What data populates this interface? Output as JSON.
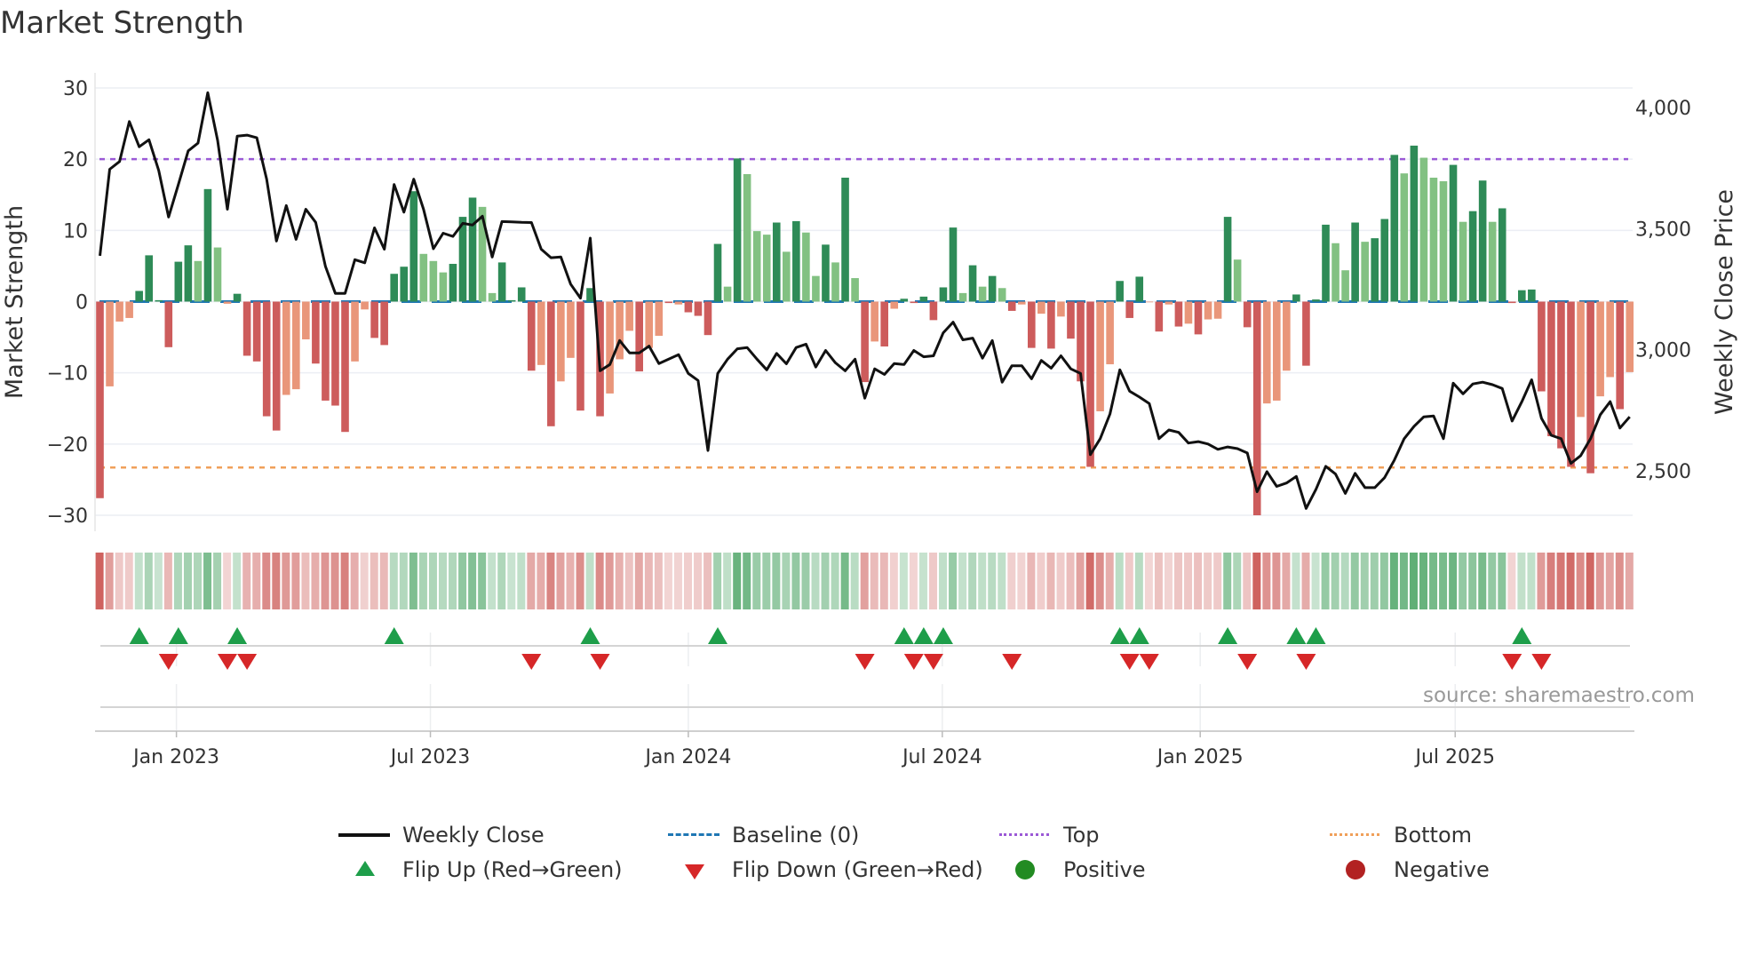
{
  "chart_data": {
    "type": "bar",
    "title": "Market Strength",
    "ylabel": "Market Strength",
    "y2label": "Weekly Close Price",
    "ylim": [
      -32,
      32
    ],
    "y2lim": [
      2317,
      4081
    ],
    "yticks": [
      -30,
      -20,
      -10,
      0,
      10,
      20,
      30
    ],
    "ytick_labels": [
      "−30",
      "−20",
      "−10",
      "0",
      "10",
      "20",
      "30"
    ],
    "y2ticks": [
      2500,
      3000,
      3500,
      4000
    ],
    "y2tick_labels": [
      "2,500",
      "3,000",
      "3,500",
      "4,000"
    ],
    "xtick_week_index": [
      7.8,
      33.7,
      60,
      85.9,
      112.2,
      138.2
    ],
    "xtick_labels": [
      "Jan 2023",
      "Jul 2023",
      "Jan 2024",
      "Jul 2024",
      "Jan 2025",
      "Jul 2025"
    ],
    "top_level": 20,
    "bottom_level": -23.3,
    "baseline": 0,
    "strength": [
      -27.6,
      -11.9,
      -2.8,
      -2.3,
      1.5,
      6.5,
      0.2,
      -6.4,
      5.6,
      7.9,
      5.7,
      15.8,
      7.6,
      -0.3,
      1.1,
      -7.6,
      -8.4,
      -16.1,
      -18.1,
      -13.1,
      -12.3,
      -5.3,
      -8.7,
      -13.9,
      -14.6,
      -18.3,
      -8.4,
      -1.1,
      -5.1,
      -6.1,
      3.9,
      4.9,
      15.5,
      6.7,
      5.7,
      4.1,
      5.3,
      11.9,
      14.6,
      13.3,
      1.2,
      5.5,
      0.2,
      2.0,
      -9.7,
      -8.9,
      -17.5,
      -11.2,
      -7.9,
      -15.3,
      1.9,
      -16.1,
      -12.9,
      -8.1,
      -4.1,
      -9.8,
      -6.5,
      -4.8,
      -0.2,
      -0.4,
      -1.5,
      -2.0,
      -4.7,
      8.1,
      2.1,
      20.1,
      17.9,
      9.9,
      9.4,
      11.1,
      7.0,
      11.3,
      9.7,
      3.6,
      8.0,
      5.5,
      17.4,
      3.3,
      -11.3,
      -5.6,
      -6.3,
      -1.0,
      0.4,
      -0.2,
      0.7,
      -2.6,
      2.0,
      10.4,
      1.2,
      5.1,
      2.1,
      3.6,
      1.9,
      -1.3,
      -0.4,
      -6.5,
      -1.7,
      -6.6,
      -2.1,
      -5.2,
      -11.2,
      -23.2,
      -15.4,
      -8.8,
      2.9,
      -2.3,
      3.5,
      -0.1,
      -4.2,
      -0.4,
      -3.5,
      -3.1,
      -4.6,
      -2.5,
      -2.4,
      11.9,
      5.9,
      -3.6,
      -30.0,
      -14.3,
      -13.9,
      -9.7,
      1.0,
      -9.0,
      0.3,
      10.8,
      8.2,
      4.4,
      11.1,
      8.4,
      8.9,
      11.6,
      20.6,
      18.0,
      21.9,
      20.2,
      17.4,
      16.9,
      19.2,
      11.2,
      12.7,
      17.0,
      11.2,
      13.1,
      -0.2,
      1.6,
      1.7,
      -12.6,
      -18.9,
      -20.6,
      -23.2,
      -16.2,
      -24.1,
      -13.3,
      -10.6,
      -15.1,
      -9.9
    ],
    "shade": [
      "D",
      "L",
      "L",
      "L",
      "D",
      "D",
      "D",
      "D",
      "D",
      "D",
      "L",
      "D",
      "L",
      "L",
      "D",
      "D",
      "D",
      "D",
      "D",
      "L",
      "L",
      "L",
      "D",
      "D",
      "D",
      "D",
      "L",
      "L",
      "D",
      "D",
      "D",
      "D",
      "D",
      "L",
      "L",
      "L",
      "D",
      "D",
      "D",
      "L",
      "L",
      "D",
      "D",
      "D",
      "D",
      "L",
      "D",
      "L",
      "L",
      "D",
      "D",
      "D",
      "L",
      "L",
      "L",
      "D",
      "L",
      "L",
      "D",
      "L",
      "D",
      "D",
      "D",
      "D",
      "L",
      "D",
      "L",
      "L",
      "L",
      "D",
      "L",
      "D",
      "L",
      "L",
      "D",
      "L",
      "D",
      "L",
      "D",
      "L",
      "D",
      "L",
      "D",
      "D",
      "D",
      "D",
      "D",
      "D",
      "L",
      "D",
      "L",
      "D",
      "L",
      "D",
      "L",
      "D",
      "L",
      "D",
      "L",
      "D",
      "D",
      "D",
      "L",
      "L",
      "D",
      "D",
      "D",
      "L",
      "D",
      "L",
      "D",
      "L",
      "D",
      "L",
      "L",
      "D",
      "L",
      "D",
      "D",
      "L",
      "L",
      "L",
      "D",
      "D",
      "D",
      "D",
      "L",
      "L",
      "D",
      "L",
      "D",
      "D",
      "D",
      "L",
      "D",
      "L",
      "L",
      "L",
      "D",
      "L",
      "D",
      "D",
      "L",
      "D",
      "D",
      "D",
      "D",
      "D",
      "D",
      "D",
      "D",
      "L",
      "D",
      "L",
      "L",
      "D",
      "L"
    ],
    "weekly_close": [
      3388,
      3745,
      3777,
      3942,
      3838,
      3867,
      3740,
      3548,
      3682,
      3821,
      3853,
      4061,
      3864,
      3580,
      3882,
      3886,
      3875,
      3704,
      3449,
      3595,
      3456,
      3580,
      3526,
      3344,
      3233,
      3233,
      3372,
      3359,
      3503,
      3415,
      3682,
      3568,
      3704,
      3580,
      3417,
      3481,
      3468,
      3522,
      3515,
      3551,
      3383,
      3529,
      3528,
      3526,
      3525,
      3415,
      3380,
      3383,
      3271,
      3213,
      3461,
      2913,
      2939,
      3038,
      2987,
      2987,
      3015,
      2943,
      2961,
      2980,
      2902,
      2873,
      2584,
      2902,
      2961,
      3004,
      3009,
      2961,
      2917,
      2985,
      2942,
      3009,
      3023,
      2929,
      2997,
      2946,
      2913,
      2961,
      2800,
      2921,
      2898,
      2943,
      2939,
      2997,
      2971,
      2975,
      3070,
      3114,
      3041,
      3048,
      2965,
      3038,
      2866,
      2934,
      2934,
      2880,
      2956,
      2924,
      2975,
      2921,
      2902,
      2567,
      2633,
      2735,
      2917,
      2829,
      2805,
      2778,
      2633,
      2669,
      2659,
      2615,
      2621,
      2611,
      2589,
      2599,
      2592,
      2574,
      2414,
      2497,
      2436,
      2450,
      2477,
      2345,
      2424,
      2519,
      2487,
      2407,
      2490,
      2431,
      2431,
      2472,
      2545,
      2633,
      2684,
      2723,
      2727,
      2633,
      2862,
      2818,
      2859,
      2866,
      2856,
      2840,
      2706,
      2786,
      2876,
      2717,
      2647,
      2633,
      2531,
      2563,
      2633,
      2732,
      2786,
      2677,
      2723
    ],
    "flip_up_weeks": [
      4,
      8,
      14,
      30,
      50,
      63,
      82,
      84,
      86,
      104,
      106,
      115,
      122,
      124,
      145
    ],
    "flip_down_weeks": [
      7,
      13,
      15,
      44,
      51,
      78,
      83,
      85,
      93,
      105,
      107,
      117,
      123,
      144,
      147
    ],
    "legend": [
      {
        "label": "Weekly Close",
        "symbol": "line",
        "color": "#111111"
      },
      {
        "label": "Baseline (0)",
        "symbol": "dash",
        "color": "#1f77b4"
      },
      {
        "label": "Top",
        "symbol": "dot",
        "color": "#9b59d6"
      },
      {
        "label": "Bottom",
        "symbol": "dot",
        "color": "#f0a05a"
      },
      {
        "label": "Flip Up (Red→Green)",
        "symbol": "triangle-up",
        "color": "#1e9e4a"
      },
      {
        "label": "Flip Down (Green→Red)",
        "symbol": "triangle-down",
        "color": "#d62728"
      },
      {
        "label": "Positive",
        "symbol": "circle",
        "color": "#228b22"
      },
      {
        "label": "Negative",
        "symbol": "circle",
        "color": "#b22222"
      }
    ],
    "legend_placement": "bottom",
    "colors": {
      "pos_dark": "#2e8b57",
      "pos_light": "#82c182",
      "neg_dark": "#cd5c5c",
      "neg_light": "#e9967a",
      "grid": "#eceef4"
    }
  },
  "source": "source: sharemaestro.com"
}
